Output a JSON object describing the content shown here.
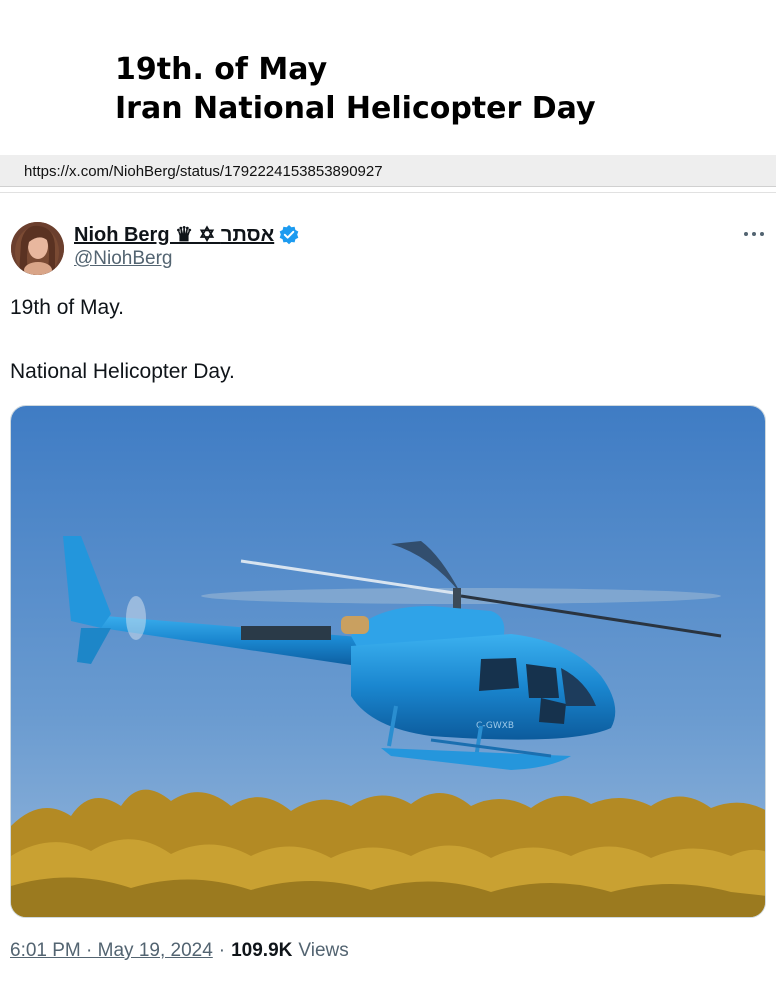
{
  "header": {
    "title_line1": "19th. of May",
    "title_line2": "Iran National Helicopter Day"
  },
  "url_bar": {
    "url": "https://x.com/NiohBerg/status/1792224153853890927"
  },
  "tweet": {
    "display_name": "Nioh Berg ♛ ✡ אסתר",
    "handle": "@NiohBerg",
    "verified_color": "#1d9bf0",
    "text_line1": "19th of May.",
    "text_line2": "National Helicopter Day.",
    "media_icon": "helicopter-photo",
    "timestamp": "6:01 PM · May 19, 2024",
    "separator": "·",
    "views_count": "109.9K",
    "views_label": "Views"
  },
  "helicopter_registration": "C-GWXB",
  "colors": {
    "sky": "#5f90c8",
    "helicopter": "#1f8fd6",
    "trees": "#c59a2a"
  }
}
